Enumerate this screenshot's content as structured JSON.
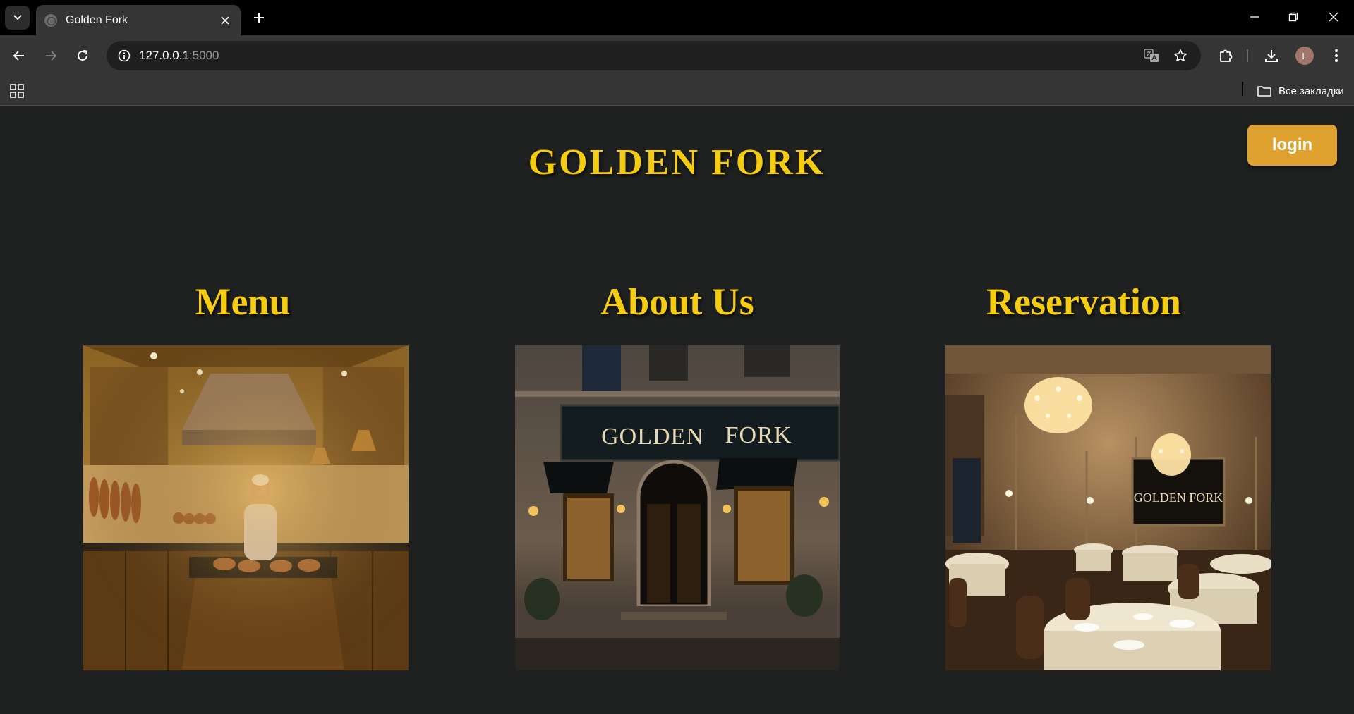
{
  "browser": {
    "tab_title": "Golden Fork",
    "url_host": "127.0.0.1",
    "url_port": ":5000",
    "avatar_letter": "L",
    "all_bookmarks_label": "Все закладки"
  },
  "site": {
    "title": "GOLDEN FORK",
    "login_label": "login"
  },
  "sections": [
    {
      "heading": "Menu"
    },
    {
      "heading": "About Us",
      "sign_text_left": "GOLDEN",
      "sign_text_right": "FORK"
    },
    {
      "heading": "Reservation",
      "sign_text": "GOLDEN FORK"
    }
  ],
  "colors": {
    "page_bg": "#1f2121",
    "accent_gold": "#f5cc10",
    "login_button": "#e0a22e"
  }
}
